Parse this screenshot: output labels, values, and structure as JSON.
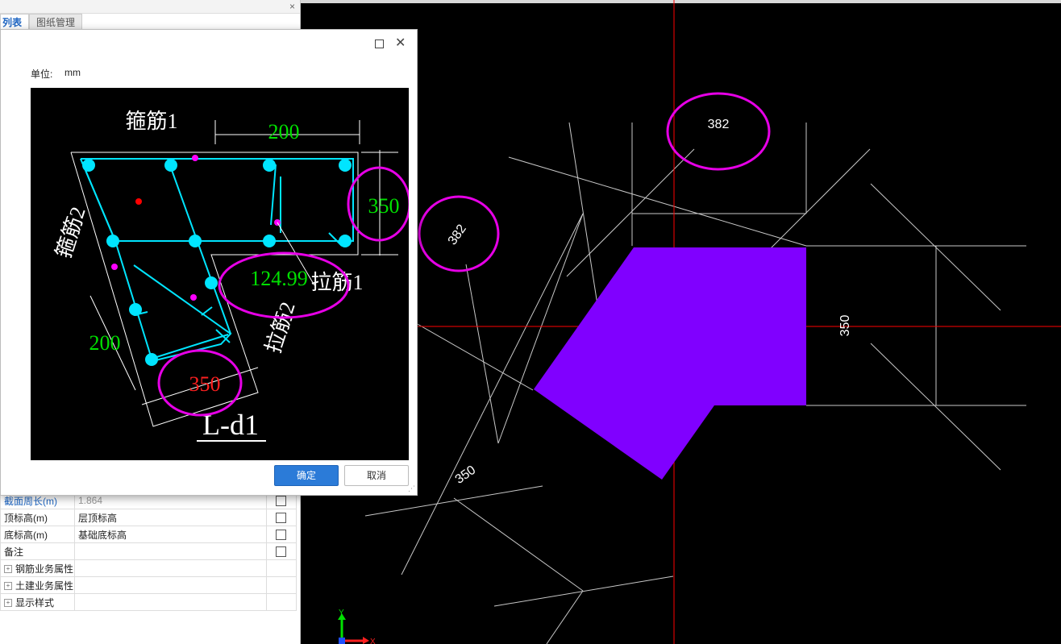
{
  "panel": {
    "tabs": [
      "列表",
      "图纸管理"
    ],
    "close_glyph": "×",
    "properties": [
      {
        "name": "截面周长(m)",
        "value": "1.864",
        "checkbox": true,
        "highlight": true
      },
      {
        "name": "顶标高(m)",
        "value": "层顶标高",
        "checkbox": true
      },
      {
        "name": "底标高(m)",
        "value": "基础底标高",
        "checkbox": true
      },
      {
        "name": "备注",
        "value": "",
        "checkbox": true
      },
      {
        "name": "钢筋业务属性",
        "group": true
      },
      {
        "name": "土建业务属性",
        "group": true
      },
      {
        "name": "显示样式",
        "group": true
      }
    ]
  },
  "dialog": {
    "unit_label": "单位:",
    "unit_value": "mm",
    "ok_label": "确定",
    "cancel_label": "取消",
    "drawing": {
      "label_stirrup1": "箍筋1",
      "label_stirrup2": "箍筋2",
      "label_tie1": "拉筋1",
      "label_tie2": "拉筋2",
      "dim_top": "200",
      "dim_right": "350",
      "dim_mid": "124.99",
      "dim_left": "200",
      "dim_bottom": "350",
      "section_name": "L-d1"
    }
  },
  "cad": {
    "dim_top": "382",
    "dim_left": "382",
    "dim_right": "350",
    "dim_bottom_left": "350",
    "axis_y": "Y",
    "axis_x": "X"
  },
  "colors": {
    "shape_fill": "#8000ff",
    "highlight_ellipse": "#e600e6",
    "rebar": "#00e5ff",
    "dim_green": "#00e000",
    "dim_red": "#ff2020",
    "crosshair": "#ff0000",
    "cad_lines": "#c8c8c8",
    "ok_button": "#2b7bd8"
  }
}
